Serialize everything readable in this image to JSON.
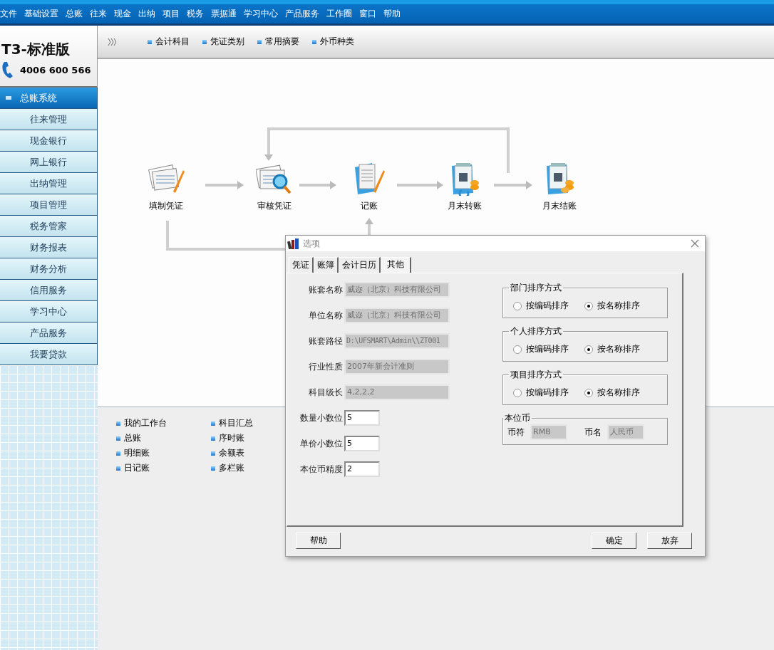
{
  "menu_bar": [
    "文件",
    "基础设置",
    "总账",
    "往来",
    "现金",
    "出纳",
    "项目",
    "税务",
    "票据通",
    "学习中心",
    "产品服务",
    "工作圈",
    "窗口",
    "帮助"
  ],
  "logo": {
    "product": "T3-标准版",
    "phone": "4006 600 566"
  },
  "sidebar": {
    "items": [
      {
        "label": "总账系统",
        "selected": true
      },
      {
        "label": "往来管理",
        "selected": false
      },
      {
        "label": "现金银行",
        "selected": false
      },
      {
        "label": "网上银行",
        "selected": false
      },
      {
        "label": "出纳管理",
        "selected": false
      },
      {
        "label": "项目管理",
        "selected": false
      },
      {
        "label": "税务管家",
        "selected": false
      },
      {
        "label": "财务报表",
        "selected": false
      },
      {
        "label": "财务分析",
        "selected": false
      },
      {
        "label": "信用服务",
        "selected": false
      },
      {
        "label": "学习中心",
        "selected": false
      },
      {
        "label": "产品服务",
        "selected": false
      },
      {
        "label": "我要贷款",
        "selected": false
      }
    ]
  },
  "toolbar": {
    "links": [
      "会计科目",
      "凭证类别",
      "常用摘要",
      "外币种类"
    ]
  },
  "flow": {
    "nodes": [
      {
        "label": "填制凭证",
        "kind": "fill"
      },
      {
        "label": "审核凭证",
        "kind": "review"
      },
      {
        "label": "记账",
        "kind": "post"
      },
      {
        "label": "月末转账",
        "kind": "transfer"
      },
      {
        "label": "月末结账",
        "kind": "close"
      }
    ]
  },
  "shortcuts": {
    "columns": [
      [
        "我的工作台",
        "总账",
        "明细账",
        "日记账"
      ],
      [
        "科目汇总",
        "序时账",
        "余额表",
        "多栏账"
      ]
    ]
  },
  "dialog": {
    "title": "选项",
    "tabs": [
      {
        "label": "凭证",
        "selected": false
      },
      {
        "label": "账簿",
        "selected": false
      },
      {
        "label": "会计日历",
        "selected": false
      },
      {
        "label": "其他",
        "selected": true
      }
    ],
    "fields": [
      {
        "label": "账套名称",
        "value": "威迩（北京）科技有限公司",
        "disabled": true
      },
      {
        "label": "单位名称",
        "value": "威迩（北京）科技有限公司",
        "disabled": true
      },
      {
        "label": "账套路径",
        "value": "D:\\UFSMART\\Admin\\\\ZT001",
        "disabled": true
      },
      {
        "label": "行业性质",
        "value": "2007年新会计准则",
        "disabled": true
      },
      {
        "label": "科目级长",
        "value": "4,2,2,2",
        "disabled": true
      },
      {
        "label": "数量小数位",
        "value": "5",
        "disabled": false
      },
      {
        "label": "单价小数位",
        "value": "5",
        "disabled": false
      },
      {
        "label": "本位币精度",
        "value": "2",
        "disabled": false
      }
    ],
    "sort_groups": [
      {
        "title": "部门排序方式",
        "options": [
          {
            "label": "按编码排序",
            "selected": false
          },
          {
            "label": "按名称排序",
            "selected": true
          }
        ]
      },
      {
        "title": "个人排序方式",
        "options": [
          {
            "label": "按编码排序",
            "selected": false
          },
          {
            "label": "按名称排序",
            "selected": true
          }
        ]
      },
      {
        "title": "项目排序方式",
        "options": [
          {
            "label": "按编码排序",
            "selected": false
          },
          {
            "label": "按名称排序",
            "selected": true
          }
        ]
      }
    ],
    "currency": {
      "title": "本位币",
      "symbol_label": "币符",
      "symbol": "RMB",
      "name_label": "币名",
      "name": "人民币"
    },
    "buttons_left": [
      "帮助"
    ],
    "buttons_right": [
      "确定",
      "放弃"
    ]
  }
}
